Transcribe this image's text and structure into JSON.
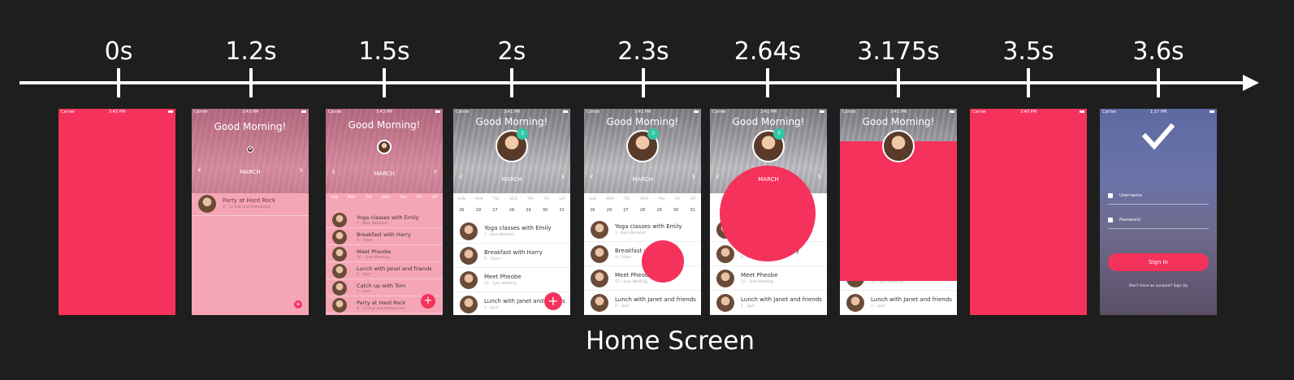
{
  "timeline": {
    "ticks": [
      "0s",
      "1.2s",
      "1.5s",
      "2s",
      "2.3s",
      "2.64s",
      "3.175s",
      "3.5s",
      "3.6s"
    ]
  },
  "caption": "Home Screen",
  "status": {
    "carrier": "Carrier",
    "times": [
      "3:43 PM",
      "3:43 PM",
      "3:43 PM",
      "3:41 PM",
      "3:41 PM",
      "3:41 PM",
      "3:41 PM",
      "3:40 PM",
      "1:17 PM"
    ]
  },
  "home": {
    "greeting": "Good Morning!",
    "month": "MARCH",
    "badge": "3",
    "weekdays": [
      "SUN",
      "MON",
      "TUE",
      "WED",
      "THU",
      "FRI",
      "SAT"
    ],
    "dates": [
      "26",
      "27",
      "28",
      "29",
      "30",
      "31",
      "1"
    ],
    "dates_alt": [
      "26",
      "29",
      "27",
      "28",
      "29",
      "30",
      "31"
    ],
    "frame2_event": {
      "title": "Party at Hard Rock",
      "sub": "8 - 12 Pub and Restaurant"
    },
    "events_full": [
      {
        "title": "Yoga classes with Emily",
        "sub": "7 - 8am Workout"
      },
      {
        "title": "Breakfast with Harry",
        "sub": "9 - 10am"
      },
      {
        "title": "Meet Pheobe",
        "sub": "10 - 1pm Meeting"
      },
      {
        "title": "Lunch with Janet and friends",
        "sub": "2 - 3pm"
      },
      {
        "title": "Catch up with Tom",
        "sub": "3 - 4pm"
      },
      {
        "title": "Party at Hard Rock",
        "sub": "8 - 12 Pub and Restaurant"
      }
    ],
    "events": [
      {
        "title": "Yoga classes with Emily",
        "sub": "7 - 8am Workout"
      },
      {
        "title": "Breakfast with Harry",
        "sub": "9 - 10am"
      },
      {
        "title": "Meet Pheobe",
        "sub": "12 - 1pm Meeting"
      },
      {
        "title": "Lunch with Janet and friends",
        "sub": "2 - 3pm"
      }
    ],
    "fab": "+"
  },
  "signin": {
    "username": "Username",
    "password": "Password",
    "button": "Sign In",
    "footer": "Don't have an account? Sign Up"
  },
  "colors": {
    "accent": "#f5325c",
    "teal": "#2fc7a7",
    "background": "#1e1e1e"
  }
}
